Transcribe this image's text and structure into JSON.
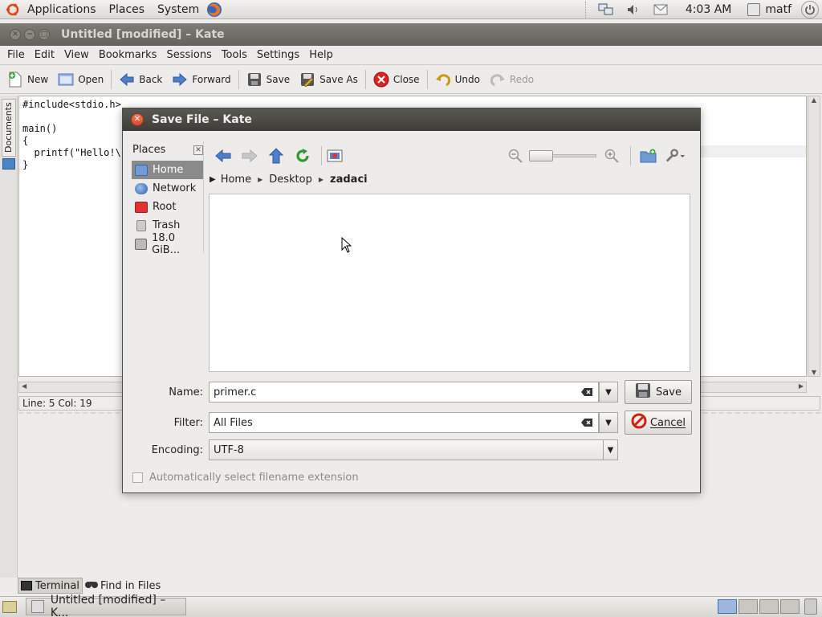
{
  "top_panel": {
    "menus": [
      "Applications",
      "Places",
      "System"
    ],
    "clock": "4:03 AM",
    "user": "matf"
  },
  "kate": {
    "title": "Untitled [modified] – Kate",
    "menu": [
      "File",
      "Edit",
      "View",
      "Bookmarks",
      "Sessions",
      "Tools",
      "Settings",
      "Help"
    ],
    "toolbar": {
      "new": "New",
      "open": "Open",
      "back": "Back",
      "forward": "Forward",
      "save": "Save",
      "save_as": "Save As",
      "close": "Close",
      "undo": "Undo",
      "redo": "Redo"
    },
    "sidebar_label": "Documents",
    "code": [
      "#include<stdio.h>",
      "",
      "main()",
      "{",
      "  printf(\"Hello!\\n",
      "}"
    ],
    "status": "Line: 5 Col: 19",
    "bottom_tools": [
      "Terminal",
      "Find in Files"
    ]
  },
  "dialog": {
    "title": "Save File – Kate",
    "places_header": "Places",
    "places": [
      "Home",
      "Network",
      "Root",
      "Trash",
      "18.0 GiB..."
    ],
    "breadcrumb": [
      "Home",
      "Desktop",
      "zadaci"
    ],
    "name_label": "Name:",
    "name_value": "primer.c",
    "filter_label": "Filter:",
    "filter_value": "All Files",
    "encoding_label": "Encoding:",
    "encoding_value": "UTF-8",
    "save_btn": "Save",
    "cancel_btn": "Cancel",
    "auto_ext": "Automatically select filename extension"
  },
  "taskbar": {
    "task_label": "Untitled [modified] – K..."
  }
}
